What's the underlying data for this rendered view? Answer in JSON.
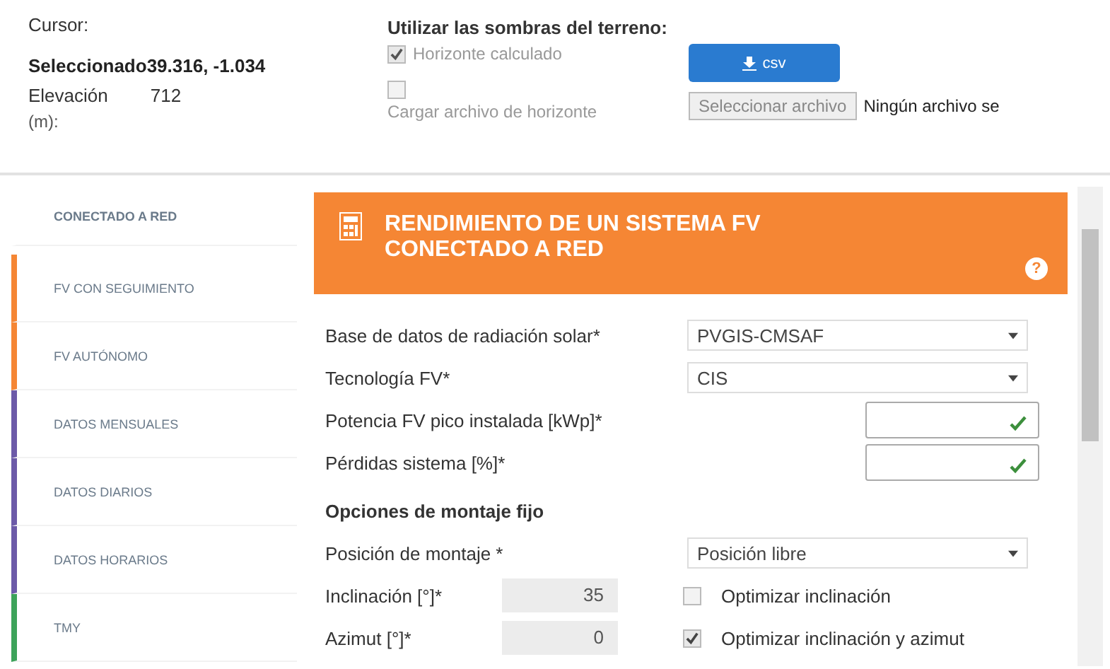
{
  "cursor": {
    "heading": "Cursor:",
    "selected_label": "Seleccionado",
    "selected_value": "39.316, -1.034",
    "elevation_label": "Elevación",
    "elevation_value": "712",
    "elevation_unit": "(m):"
  },
  "horizon": {
    "heading": "Utilizar las sombras del terreno:",
    "options": [
      {
        "label": "Horizonte calculado",
        "checked": true
      },
      {
        "label": "Cargar archivo de horizonte",
        "checked": false
      }
    ],
    "csv_button": "csv",
    "file_button": "Seleccionar archivo",
    "file_status": "Ningún archivo se"
  },
  "sidebar": {
    "items": [
      {
        "label": "CONECTADO A RED",
        "selected": true,
        "color": "#ffffff"
      },
      {
        "label": "FV CON SEGUIMIENTO",
        "selected": false,
        "color": "#f58634"
      },
      {
        "label": "FV AUTÓNOMO",
        "selected": false,
        "color": "#f58634"
      },
      {
        "label": "DATOS MENSUALES",
        "selected": false,
        "color": "#6c5aa8"
      },
      {
        "label": "DATOS DIARIOS",
        "selected": false,
        "color": "#6c5aa8"
      },
      {
        "label": "DATOS HORARIOS",
        "selected": false,
        "color": "#6c5aa8"
      },
      {
        "label": "TMY",
        "selected": false,
        "color": "#3da35a"
      }
    ]
  },
  "panel": {
    "title": "RENDIMIENTO DE UN SISTEMA FV CONECTADO A RED",
    "help": "?",
    "fields": [
      {
        "kind": "select",
        "label": "Base de datos de radiación solar*",
        "value": "PVGIS-CMSAF"
      },
      {
        "kind": "select",
        "label": "Tecnología FV*",
        "value": "CIS"
      },
      {
        "kind": "input",
        "label": "Potencia FV pico instalada [kWp]*"
      },
      {
        "kind": "input",
        "label": "Pérdidas sistema [%]*"
      }
    ],
    "mounting": {
      "heading": "Opciones de montaje fijo",
      "position_label": "Posición de montaje *",
      "position_value": "Posición libre",
      "angles": [
        {
          "label": "Inclinación [°]*",
          "value": "35",
          "option": "Optimizar inclinación",
          "checked": false
        },
        {
          "label": "Azimut [°]*",
          "value": "0",
          "option": "Optimizar inclinación y azimut",
          "checked": true
        }
      ]
    }
  }
}
